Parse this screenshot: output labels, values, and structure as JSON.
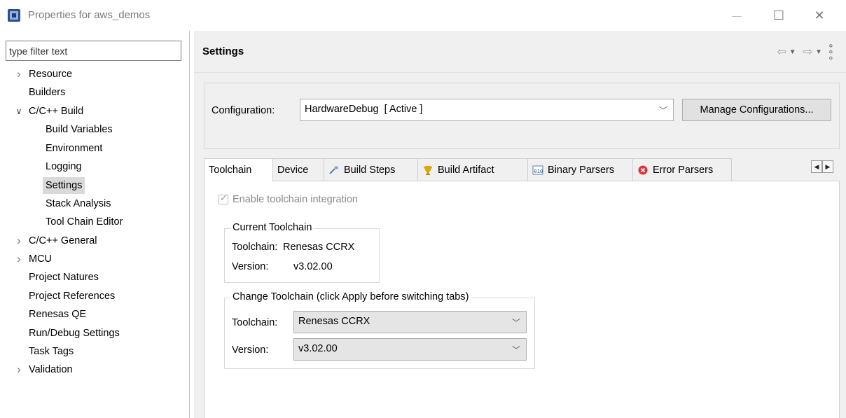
{
  "window": {
    "title": "Properties for aws_demos",
    "minimize_glyph": "—",
    "maximize_glyph": "☐",
    "close_glyph": "✕"
  },
  "filter": {
    "placeholder": "type filter text",
    "value": ""
  },
  "tree": [
    {
      "label": "Resource",
      "expandable": true,
      "expanded": false,
      "level": 0
    },
    {
      "label": "Builders",
      "expandable": false,
      "level": 0
    },
    {
      "label": "C/C++ Build",
      "expandable": true,
      "expanded": true,
      "level": 0
    },
    {
      "label": "Build Variables",
      "level": 1
    },
    {
      "label": "Environment",
      "level": 1
    },
    {
      "label": "Logging",
      "level": 1
    },
    {
      "label": "Settings",
      "level": 1,
      "selected": true
    },
    {
      "label": "Stack Analysis",
      "level": 1
    },
    {
      "label": "Tool Chain Editor",
      "level": 1
    },
    {
      "label": "C/C++ General",
      "expandable": true,
      "expanded": false,
      "level": 0
    },
    {
      "label": "MCU",
      "expandable": true,
      "expanded": false,
      "level": 0
    },
    {
      "label": "Project Natures",
      "level": 0
    },
    {
      "label": "Project References",
      "level": 0
    },
    {
      "label": "Renesas QE",
      "level": 0
    },
    {
      "label": "Run/Debug Settings",
      "level": 0
    },
    {
      "label": "Task Tags",
      "level": 0
    },
    {
      "label": "Validation",
      "expandable": true,
      "expanded": false,
      "level": 0
    }
  ],
  "header": {
    "title": "Settings"
  },
  "configuration": {
    "label": "Configuration:",
    "value": "HardwareDebug  [ Active ]",
    "manage_label": "Manage Configurations..."
  },
  "tabs": [
    {
      "label": "Toolchain",
      "icon": "none",
      "active": true
    },
    {
      "label": "Device",
      "icon": "none"
    },
    {
      "label": "Build Steps",
      "icon": "hammer-icon"
    },
    {
      "label": "Build Artifact",
      "icon": "trophy-icon"
    },
    {
      "label": "Binary Parsers",
      "icon": "binary-icon"
    },
    {
      "label": "Error Parsers",
      "icon": "error-icon"
    }
  ],
  "toolchain_panel": {
    "enable_label": "Enable toolchain integration",
    "enable_checked": true,
    "current": {
      "title": "Current Toolchain",
      "toolchain_label": "Toolchain:",
      "toolchain_value": "Renesas CCRX",
      "version_label": "Version:",
      "version_value": "v3.02.00"
    },
    "change": {
      "title": "Change Toolchain (click Apply before switching tabs)",
      "toolchain_label": "Toolchain:",
      "toolchain_value": "Renesas CCRX",
      "version_label": "Version:",
      "version_value": "v3.02.00"
    }
  },
  "colors": {
    "panel_bg": "#f0f0f0",
    "selected_bg": "#d9d9d9",
    "error_red": "#d9343b"
  }
}
